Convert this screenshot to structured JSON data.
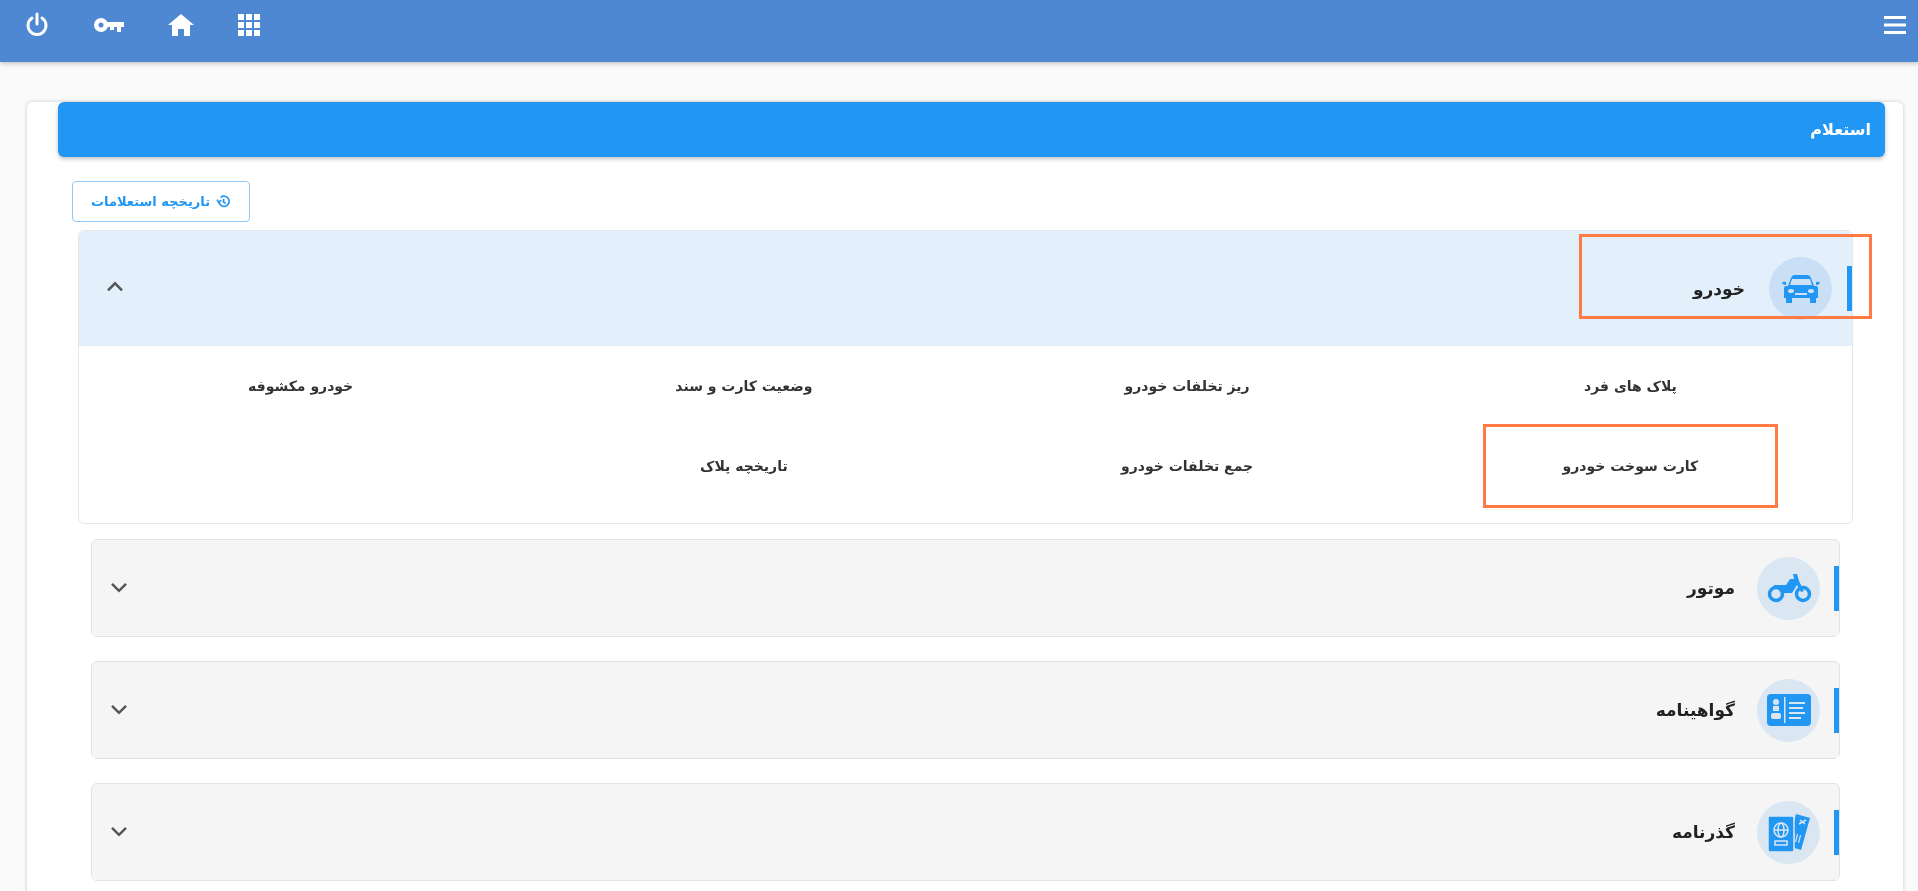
{
  "panel": {
    "title": "استعلام",
    "history_button": "تاریخچه استعلامات"
  },
  "categories": [
    {
      "title": "خودرو",
      "kind": "car",
      "expanded": true,
      "highlighted": true,
      "items": [
        {
          "label": "پلاک های فرد",
          "highlighted": false
        },
        {
          "label": "ریز تخلفات خودرو",
          "highlighted": false
        },
        {
          "label": "وضعیت کارت و سند",
          "highlighted": false
        },
        {
          "label": "خودرو مکشوفه",
          "highlighted": false
        },
        {
          "label": "کارت سوخت خودرو",
          "highlighted": true
        },
        {
          "label": "جمع تخلفات خودرو",
          "highlighted": false
        },
        {
          "label": "تاریخچه پلاک",
          "highlighted": false
        }
      ]
    },
    {
      "title": "موتور",
      "kind": "motorcycle",
      "expanded": false,
      "highlighted": false
    },
    {
      "title": "گواهینامه",
      "kind": "license",
      "expanded": false,
      "highlighted": false
    },
    {
      "title": "گذرنامه",
      "kind": "passport",
      "expanded": false,
      "highlighted": false
    }
  ]
}
